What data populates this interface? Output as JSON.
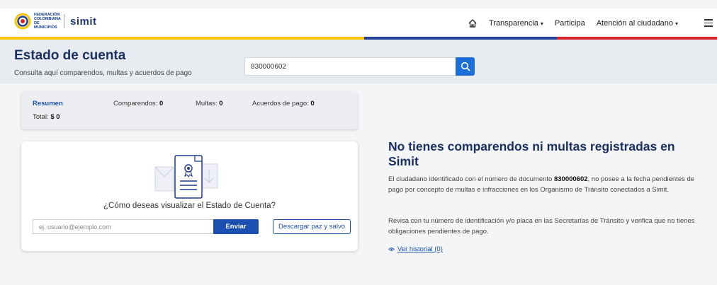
{
  "header": {
    "logo_fed_line1": "FEDERACIÓN",
    "logo_fed_line2": "COLOMBIANA",
    "logo_fed_line3": "DE MUNICIPIOS",
    "logo_brand": "simit",
    "nav": [
      {
        "label": "Transparencia",
        "has_caret": true
      },
      {
        "label": "Participa",
        "has_caret": false
      },
      {
        "label": "Atención al ciudadano",
        "has_caret": true
      }
    ],
    "caret": "▾"
  },
  "page": {
    "title": "Estado de cuenta",
    "subtitle": "Consulta aquí comparendos, multas y acuerdos de pago",
    "search_value": "830000602"
  },
  "summary": {
    "resumen_label": "Resumen",
    "comparendos_label": "Comparendos: ",
    "comparendos_value": "0",
    "multas_label": "Multas: ",
    "multas_value": "0",
    "acuerdos_label": "Acuerdos de pago: ",
    "acuerdos_value": "0",
    "total_label": "Total: ",
    "total_value": "$ 0"
  },
  "visualize": {
    "question": "¿Cómo deseas visualizar el Estado de Cuenta?",
    "email_placeholder": "ej. usuario@ejemplo.com",
    "send_label": "Enviar",
    "download_label": "Descargar paz y salvo"
  },
  "message": {
    "title": "No tienes comparendos ni multas registradas en Simit",
    "p1_before": "El ciudadano identificado con el número de documento ",
    "p1_doc": "830000602",
    "p1_after": ", no posee a la fecha pendientes de pago por concepto de multas e infracciones en los Organismo de Tránsito conectados a Simit.",
    "p2": "Revisa con tu número de identificación y/o placa en las Secretarías de Tránsito y verifica que no tienes obligaciones pendientes de pago.",
    "history_link": "Ver historial (0)"
  },
  "colors": {
    "brand_navy": "#1c3064",
    "primary_blue": "#1c50b0",
    "search_blue": "#1c6fd9",
    "flag_yellow": "#f7c600",
    "flag_blue": "#24409a",
    "flag_red": "#d8232a"
  },
  "icons": [
    "home-icon",
    "search-icon",
    "menu-icon",
    "eye-icon",
    "document-certificate-icon"
  ]
}
